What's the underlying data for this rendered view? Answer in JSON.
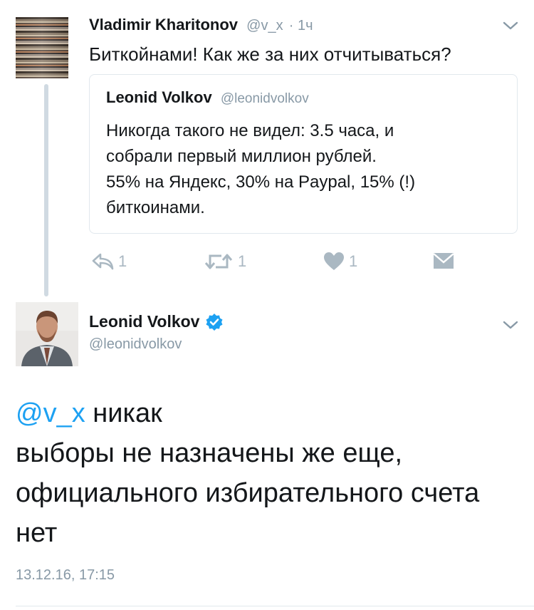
{
  "retweeted_tweet": {
    "author_name": "Vladimir Kharitonov",
    "author_handle": "@v_x",
    "time": "· 1ч",
    "text": "Биткойнами! Как же за них отчитываться?",
    "quoted": {
      "author_name": "Leonid Volkov",
      "author_handle": "@leonidvolkov",
      "lines": [
        "Никогда такого не видел: 3.5 часа, и",
        "собрали первый миллион рублей.",
        "55% на Яндекс, 30% на Paypal, 15% (!)",
        "биткоинами."
      ]
    },
    "actions": {
      "reply_count": "1",
      "retweet_count": "1",
      "like_count": "1"
    }
  },
  "main_tweet": {
    "author_name": "Leonid Volkov",
    "author_handle": "@leonidvolkov",
    "mention": "@v_x",
    "line1": " никак",
    "line2": "выборы не назначены же еще,",
    "line3": "официального избирательного счета",
    "line4": "нет",
    "timestamp": "13.12.16, 17:15"
  },
  "colors": {
    "link": "#1da1f2",
    "muted": "#8899a6",
    "action_icon": "#aab8c2",
    "verified": "#1da1f2"
  },
  "icons": [
    "chevron-down-icon",
    "reply-icon",
    "retweet-icon",
    "heart-icon",
    "direct-message-icon",
    "verified-badge-icon"
  ]
}
